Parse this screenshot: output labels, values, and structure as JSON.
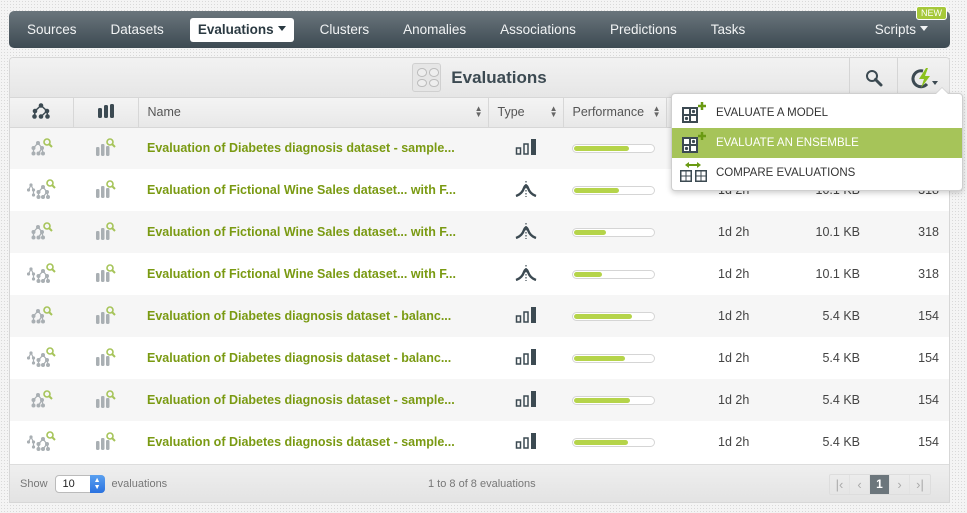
{
  "nav": {
    "items": [
      {
        "label": "Sources",
        "active": false
      },
      {
        "label": "Datasets",
        "active": false
      },
      {
        "label": "Evaluations",
        "active": true
      },
      {
        "label": "Clusters",
        "active": false
      },
      {
        "label": "Anomalies",
        "active": false
      },
      {
        "label": "Associations",
        "active": false
      },
      {
        "label": "Predictions",
        "active": false
      },
      {
        "label": "Tasks",
        "active": false
      }
    ],
    "scripts_label": "Scripts",
    "new_badge": "NEW"
  },
  "panel": {
    "title": "Evaluations",
    "search_icon": "search-icon",
    "action_icon": "bolt-refresh-icon"
  },
  "table": {
    "columns": [
      "model-tree-icon",
      "bar-chart-icon",
      "Name",
      "Type",
      "Performance"
    ],
    "rows": [
      {
        "name": "Evaluation of Diabetes diagnosis dataset - sample...",
        "type": "classification",
        "performance": 0.7,
        "age": "",
        "size": "",
        "count": ""
      },
      {
        "name": "Evaluation of Fictional Wine Sales dataset... with F...",
        "type": "regression",
        "performance": 0.57,
        "age": "1d 2h",
        "size": "10.1 KB",
        "count": "318"
      },
      {
        "name": "Evaluation of Fictional Wine Sales dataset... with F...",
        "type": "regression",
        "performance": 0.4,
        "age": "1d 2h",
        "size": "10.1 KB",
        "count": "318"
      },
      {
        "name": "Evaluation of Fictional Wine Sales dataset... with F...",
        "type": "regression",
        "performance": 0.35,
        "age": "1d 2h",
        "size": "10.1 KB",
        "count": "318"
      },
      {
        "name": "Evaluation of Diabetes diagnosis dataset - balanc...",
        "type": "classification",
        "performance": 0.73,
        "age": "1d 2h",
        "size": "5.4 KB",
        "count": "154"
      },
      {
        "name": "Evaluation of Diabetes diagnosis dataset - balanc...",
        "type": "classification",
        "performance": 0.65,
        "age": "1d 2h",
        "size": "5.4 KB",
        "count": "154"
      },
      {
        "name": "Evaluation of Diabetes diagnosis dataset - sample...",
        "type": "classification",
        "performance": 0.71,
        "age": "1d 2h",
        "size": "5.4 KB",
        "count": "154"
      },
      {
        "name": "Evaluation of Diabetes diagnosis dataset - sample...",
        "type": "classification",
        "performance": 0.68,
        "age": "1d 2h",
        "size": "5.4 KB",
        "count": "154"
      }
    ]
  },
  "footer": {
    "show_label": "Show",
    "page_size": "10",
    "unit_label": "evaluations",
    "range_label": "1 to 8 of 8 evaluations",
    "current_page": "1"
  },
  "dropdown": {
    "items": [
      {
        "label": "EVALUATE A MODEL",
        "highlighted": false
      },
      {
        "label": "EVALUATE AN ENSEMBLE",
        "highlighted": true
      },
      {
        "label": "COMPARE EVALUATIONS",
        "highlighted": false
      }
    ]
  },
  "colors": {
    "accent_green": "#a6c459",
    "link_green": "#7a9a12",
    "progress_green": "#b5d44a",
    "nav_dark": "#3d4a52"
  }
}
